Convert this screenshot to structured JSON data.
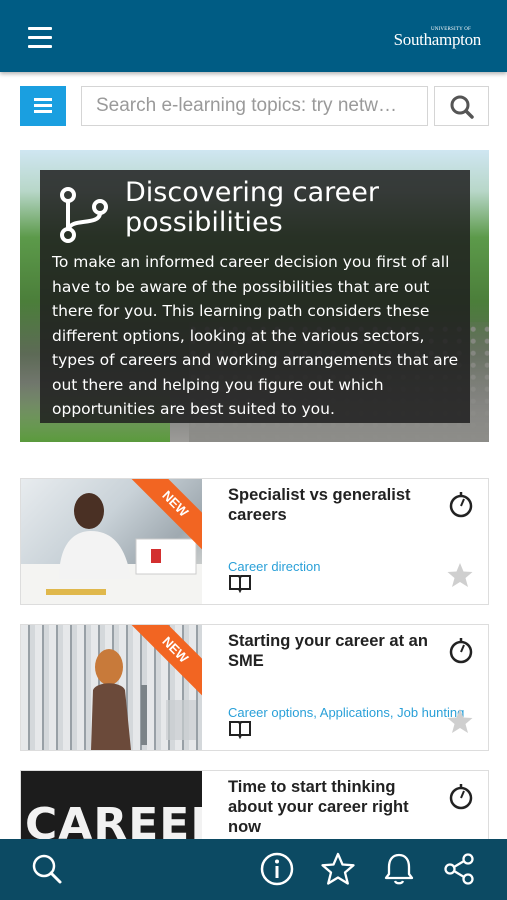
{
  "header": {
    "menu_icon": "hamburger-icon",
    "logo_small": "UNIVERSITY OF",
    "logo_big": "Southampton"
  },
  "search": {
    "menu_icon": "hamburger-icon",
    "placeholder": "Search e-learning topics: try netw…",
    "button_icon": "search-icon"
  },
  "hero": {
    "icon": "branch-path-icon",
    "title": "Discovering career possibilities",
    "description": "To make an informed career decision you first of all have to be aware of the possibilities that are out there for you. This learning path considers these different options, looking at the various sectors, types of careers and working arrangements that are out there and helping you figure out which opportunities are best suited to you."
  },
  "cards": [
    {
      "title": "Specialist vs generalist careers",
      "tags": "Career direction",
      "badge": "NEW",
      "icons": [
        "timer-icon",
        "book-icon",
        "star-icon"
      ]
    },
    {
      "title": "Starting your career at an SME",
      "tags": "Career options, Applications, Job hunting",
      "badge": "NEW",
      "icons": [
        "timer-icon",
        "book-icon",
        "star-icon"
      ]
    },
    {
      "title": "Time to start thinking about your career right now",
      "image_text": "CAREER",
      "icons": [
        "timer-icon"
      ]
    }
  ],
  "bottom_nav": [
    "search-icon",
    "info-icon",
    "star-icon",
    "bell-icon",
    "share-icon"
  ],
  "colors": {
    "header": "#005c84",
    "bottom_bar": "#0c4a63",
    "accent": "#1a9fe0",
    "badge": "#f26522",
    "tag_text": "#2aa0d8"
  }
}
